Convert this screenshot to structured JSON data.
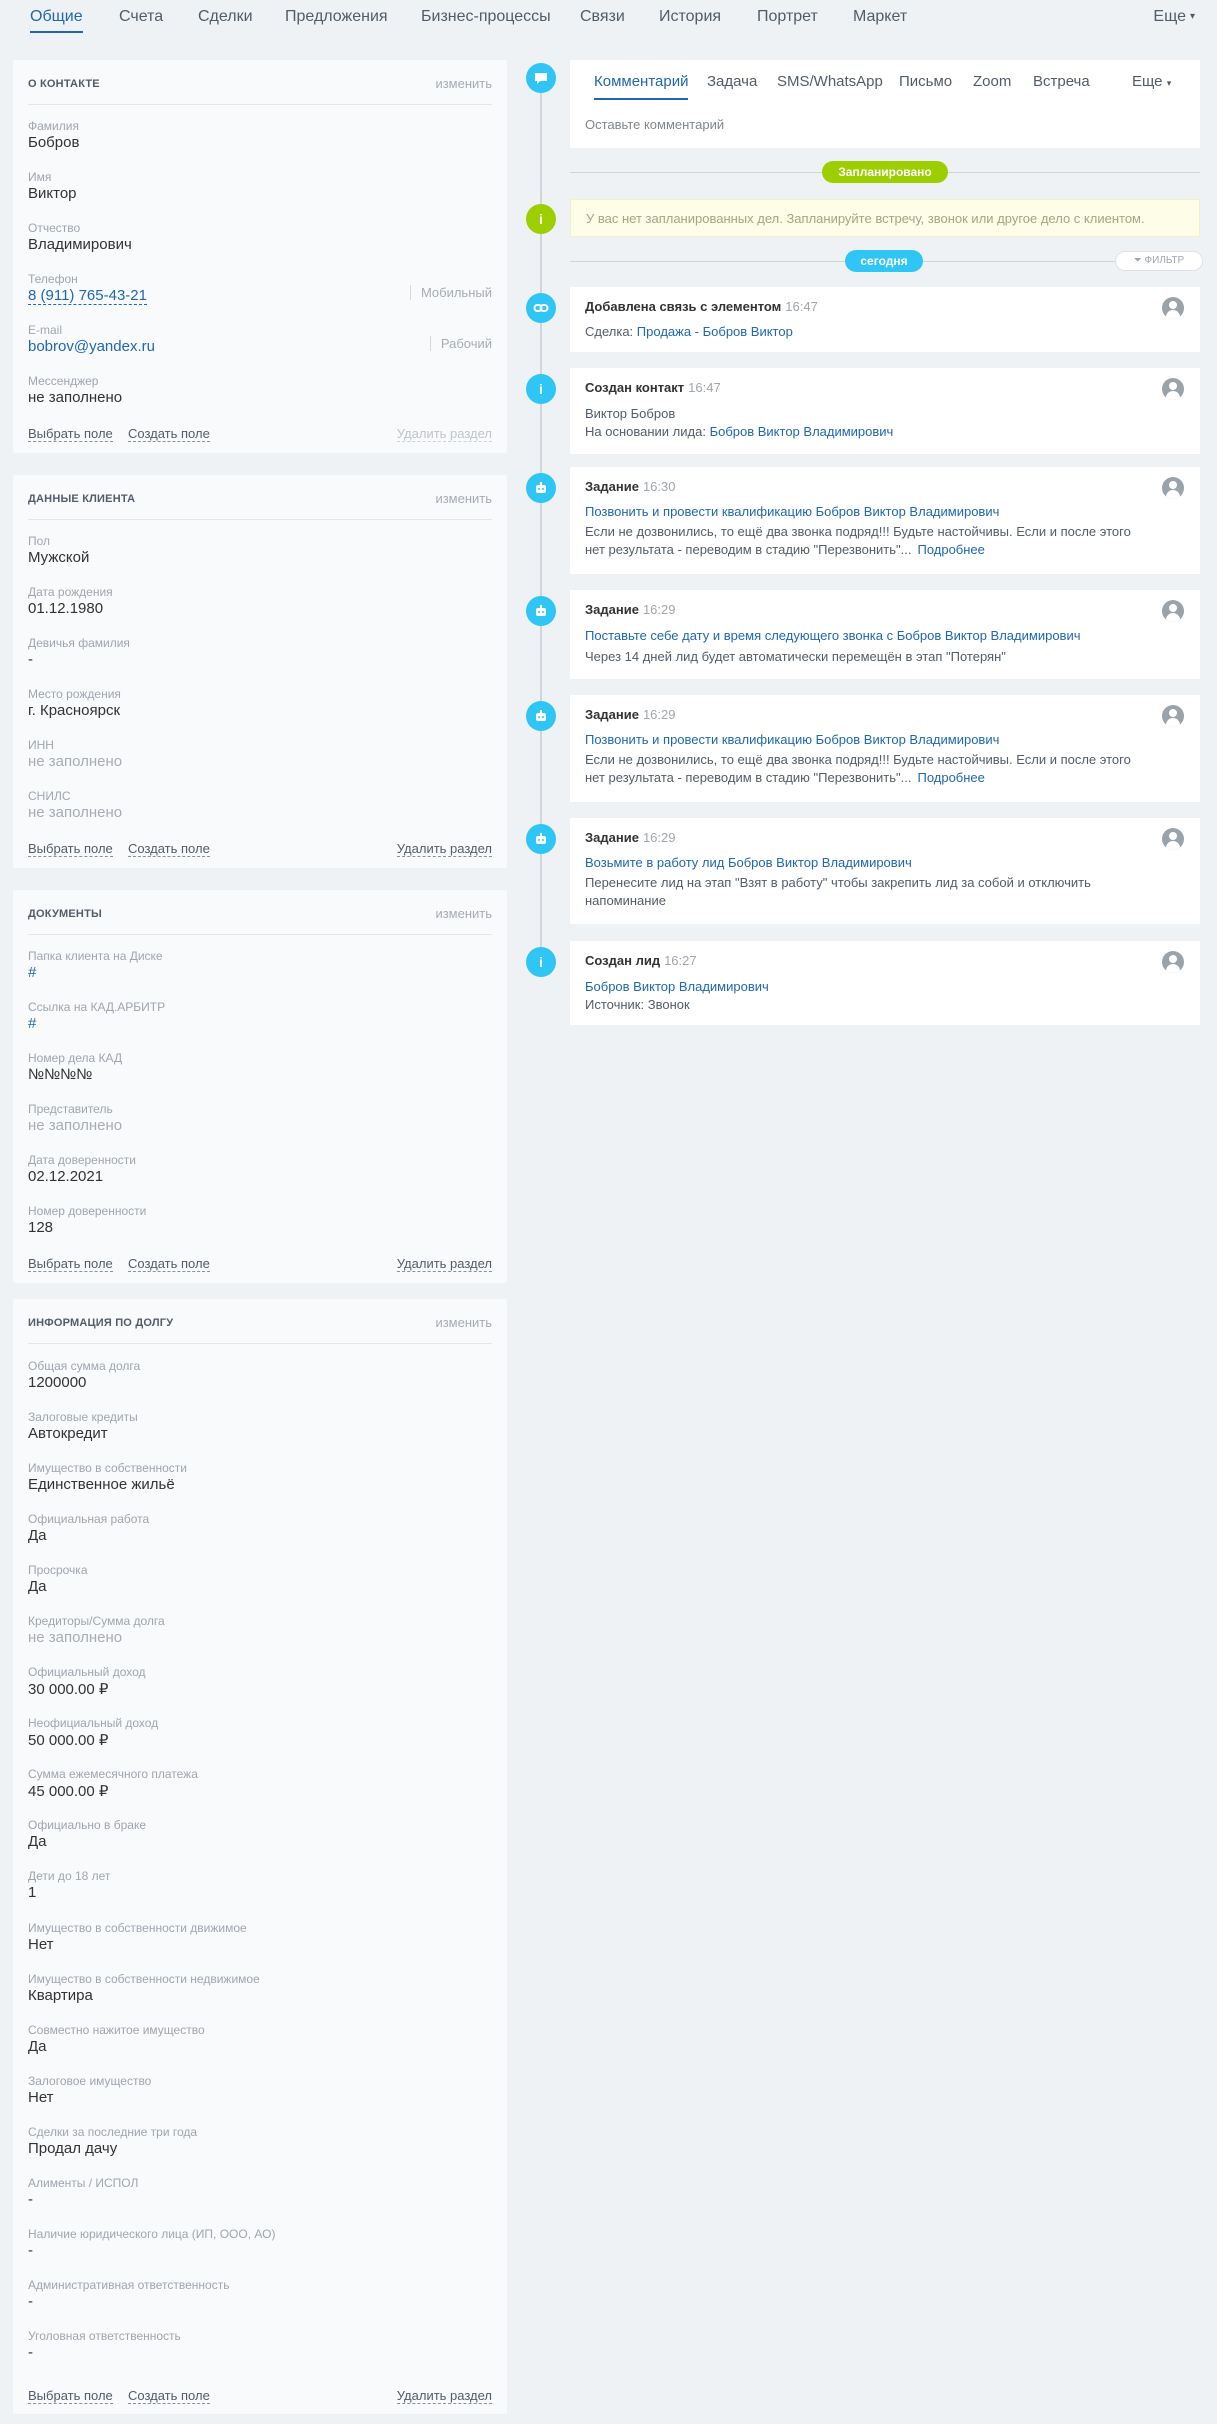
{
  "tabs": [
    {
      "label": "Общие"
    },
    {
      "label": "Счета"
    },
    {
      "label": "Сделки"
    },
    {
      "label": "Предложения"
    },
    {
      "label": "Бизнес-процессы"
    },
    {
      "label": "Связи"
    },
    {
      "label": "История"
    },
    {
      "label": "Портрет"
    },
    {
      "label": "Маркет"
    }
  ],
  "more_tab": "Еще",
  "contact": {
    "title": "О КОНТАКТЕ",
    "edit": "изменить",
    "fields": [
      {
        "label": "Фамилия",
        "value": "Бобров"
      },
      {
        "label": "Имя",
        "value": "Виктор"
      },
      {
        "label": "Отчество",
        "value": "Владимирович"
      },
      {
        "label": "Телефон",
        "value": "8 (911) 765-43-21",
        "sub": "Мобильный"
      },
      {
        "label": "E-mail",
        "value": "bobrov@yandex.ru",
        "sub": "Рабочий"
      },
      {
        "label": "Мессенджер",
        "value": "не заполнено"
      }
    ],
    "select_field": "Выбрать поле",
    "create_field": "Создать поле",
    "delete_section": "Удалить раздел"
  },
  "client": {
    "title": "ДАННЫЕ КЛИЕНТА",
    "edit": "изменить",
    "fields": [
      {
        "label": "Пол",
        "value": "Мужской"
      },
      {
        "label": "Дата рождения",
        "value": "01.12.1980"
      },
      {
        "label": "Девичья фамилия",
        "value": "-"
      },
      {
        "label": "Место рождения",
        "value": "г. Красноярск"
      },
      {
        "label": "ИНН",
        "value": "не заполнено"
      },
      {
        "label": "СНИЛС",
        "value": "не заполнено"
      }
    ],
    "select_field": "Выбрать поле",
    "create_field": "Создать поле",
    "delete_section": "Удалить раздел"
  },
  "documents": {
    "title": "ДОКУМЕНТЫ",
    "edit": "изменить",
    "fields": [
      {
        "label": "Папка клиента на Диске",
        "value": "#"
      },
      {
        "label": "Ссылка на КАД.АРБИТР",
        "value": "#"
      },
      {
        "label": "Номер дела КАД",
        "value": "№№№№"
      },
      {
        "label": "Представитель",
        "value": "не заполнено"
      },
      {
        "label": "Дата доверенности",
        "value": "02.12.2021"
      },
      {
        "label": "Номер доверенности",
        "value": "128"
      }
    ],
    "select_field": "Выбрать поле",
    "create_field": "Создать поле",
    "delete_section": "Удалить раздел"
  },
  "debt": {
    "title": "ИНФОРМАЦИЯ ПО ДОЛГУ",
    "edit": "изменить",
    "fields": [
      {
        "label": "Общая сумма долга",
        "value": "1200000"
      },
      {
        "label": "Залоговые кредиты",
        "value": "Автокредит"
      },
      {
        "label": "Имущество в собственности",
        "value": "Единственное жильё"
      },
      {
        "label": "Официальная работа",
        "value": "Да"
      },
      {
        "label": "Просрочка",
        "value": "Да"
      },
      {
        "label": "Кредиторы/Сумма долга",
        "value": "не заполнено"
      },
      {
        "label": "Официальный доход",
        "value": "30 000.00 ₽"
      },
      {
        "label": "Неофициальный доход",
        "value": "50 000.00 ₽"
      },
      {
        "label": "Сумма ежемесячного платежа",
        "value": "45 000.00 ₽"
      },
      {
        "label": "Официально в браке",
        "value": "Да"
      },
      {
        "label": "Дети до 18 лет",
        "value": "1"
      },
      {
        "label": "Имущество в собственности движимое",
        "value": "Нет"
      },
      {
        "label": "Имущество в собственности недвижимое",
        "value": "Квартира"
      },
      {
        "label": "Совместно нажитое имущество",
        "value": "Да"
      },
      {
        "label": "Залоговое имущество",
        "value": "Нет"
      },
      {
        "label": "Сделки за последние три года",
        "value": "Продал дачу"
      },
      {
        "label": "Алименты / ИСПОЛ",
        "value": "-"
      },
      {
        "label": "Наличие юридического лица (ИП, ООО, АО)",
        "value": "-"
      },
      {
        "label": "Административная ответственность",
        "value": "-"
      },
      {
        "label": "Уголовная ответственность",
        "value": "-"
      }
    ],
    "select_field": "Выбрать поле",
    "create_field": "Создать поле",
    "delete_section": "Удалить раздел"
  },
  "composer": {
    "tabs": [
      {
        "label": "Комментарий"
      },
      {
        "label": "Задача"
      },
      {
        "label": "SMS/WhatsApp"
      },
      {
        "label": "Письмо"
      },
      {
        "label": "Zoom"
      },
      {
        "label": "Встреча"
      }
    ],
    "more": "Еще",
    "placeholder": "Оставьте комментарий"
  },
  "planned_pill": "Запланировано",
  "planned_notice": "У вас нет запланированных дел. Запланируйте встречу, звонок или другое дело с клиентом.",
  "today_pill": "сегодня",
  "filter_label": "ФИЛЬТР",
  "entries": [
    {
      "title": "Добавлена связь с элементом",
      "time": "16:47",
      "l1_prefix": "Сделка: ",
      "l1_link": "Продажа - Бобров Виктор"
    },
    {
      "title": "Создан контакт",
      "time": "16:47",
      "l1": "Виктор Бобров",
      "l2_prefix": "На основании лида: ",
      "l2_link": "Бобров Виктор Владимирович"
    },
    {
      "title": "Задание",
      "time": "16:30",
      "link": "Позвонить и провести квалификацию Бобров Виктор Владимирович",
      "t1": "Если не дозвонились, то ещё два звонка подряд!!! Будьте настойчивы. Если и после этого",
      "t2": "нет результата - переводим в стадию \"Перезвонить\"...",
      "more": "Подробнее"
    },
    {
      "title": "Задание",
      "time": "16:29",
      "link": "Поставьте себе дату и время следующего звонка с Бобров Виктор Владимирович",
      "t1": "Через 14 дней лид будет автоматически перемещён в этап \"Потерян\""
    },
    {
      "title": "Задание",
      "time": "16:29",
      "link": "Позвонить и провести квалификацию Бобров Виктор Владимирович",
      "t1": "Если не дозвонились, то ещё два звонка подряд!!! Будьте настойчивы. Если и после этого",
      "t2": "нет результата - переводим в стадию \"Перезвонить\"...",
      "more": "Подробнее"
    },
    {
      "title": "Задание",
      "time": "16:29",
      "link": "Возьмите в работу лид Бобров Виктор Владимирович",
      "t1": "Перенесите лид на этап \"Взят в работу\" чтобы закрепить лид за собой и отключить",
      "t2": "напоминание"
    },
    {
      "title": "Создан лид",
      "time": "16:27",
      "link": "Бобров Виктор Владимирович",
      "t1": "Источник: Звонок"
    }
  ],
  "colors": {
    "accent": "#2067b0",
    "timeline_blue": "#2fc6f6",
    "timeline_green": "#9dcf00"
  }
}
